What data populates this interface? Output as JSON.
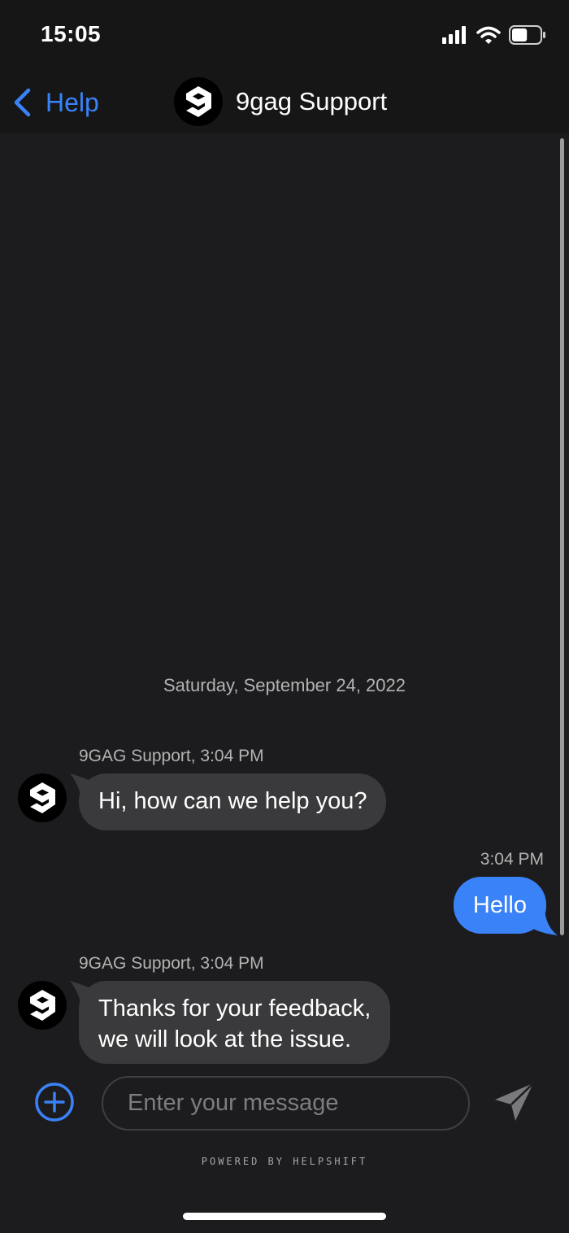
{
  "status_bar": {
    "time": "15:05",
    "icons": [
      "signal-bars-icon",
      "wifi-icon",
      "battery-icon"
    ],
    "battery_level": 0.55
  },
  "nav": {
    "back_label": "Help",
    "title": "9gag Support",
    "avatar_icon": "9gag-logo-icon"
  },
  "chat": {
    "date_separator": "Saturday, September 24, 2022",
    "messages": [
      {
        "direction": "incoming",
        "meta": "9GAG Support, 3:04 PM",
        "text": "Hi, how can we help you?"
      },
      {
        "direction": "outgoing",
        "meta": "3:04 PM",
        "text": "Hello"
      },
      {
        "direction": "incoming",
        "meta": "9GAG Support, 3:04 PM",
        "text_lines": [
          "Thanks for your feedback,",
          "we will look at the issue."
        ]
      }
    ]
  },
  "composer": {
    "placeholder": "Enter your message",
    "add_icon": "plus-circle-icon",
    "send_icon": "send-icon"
  },
  "footer": {
    "powered_by": "POWERED BY HELPSHIFT"
  },
  "colors": {
    "accent": "#3a82f7",
    "background": "#1c1c1e",
    "bar": "#161616",
    "incoming_bubble": "#3a3a3c",
    "outgoing_bubble": "#3a82f7"
  }
}
